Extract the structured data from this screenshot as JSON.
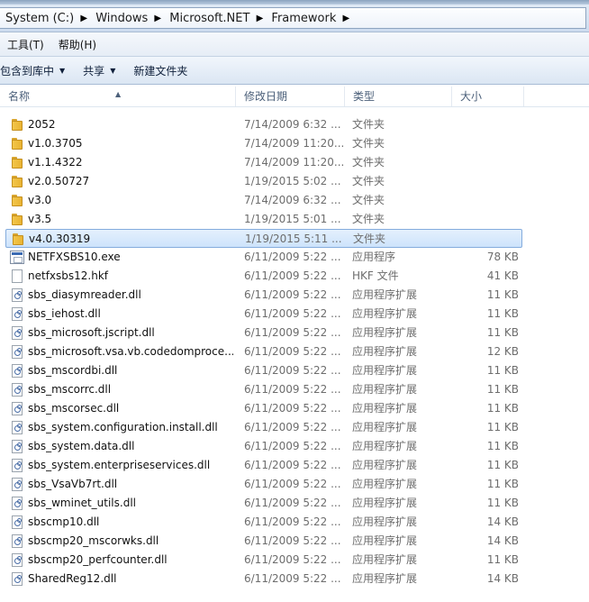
{
  "address": {
    "crumbs": [
      "System (C:)",
      "Windows",
      "Microsoft.NET",
      "Framework"
    ]
  },
  "menu": [
    "工具(T)",
    "帮助(H)"
  ],
  "toolbar": {
    "include_in_library": "包含到库中",
    "share": "共享",
    "new_folder": "新建文件夹"
  },
  "columns": {
    "name": "名称",
    "date": "修改日期",
    "type": "类型",
    "size": "大小"
  },
  "files": [
    {
      "name": "2052",
      "date": "7/14/2009 6:32 ...",
      "type": "文件夹",
      "size": "",
      "icon": "folder-icon"
    },
    {
      "name": "v1.0.3705",
      "date": "7/14/2009 11:20...",
      "type": "文件夹",
      "size": "",
      "icon": "folder-icon"
    },
    {
      "name": "v1.1.4322",
      "date": "7/14/2009 11:20...",
      "type": "文件夹",
      "size": "",
      "icon": "folder-icon"
    },
    {
      "name": "v2.0.50727",
      "date": "1/19/2015 5:02 ...",
      "type": "文件夹",
      "size": "",
      "icon": "folder-icon"
    },
    {
      "name": "v3.0",
      "date": "7/14/2009 6:32 ...",
      "type": "文件夹",
      "size": "",
      "icon": "folder-icon"
    },
    {
      "name": "v3.5",
      "date": "1/19/2015 5:01 ...",
      "type": "文件夹",
      "size": "",
      "icon": "folder-icon"
    },
    {
      "name": "v4.0.30319",
      "date": "1/19/2015 5:11 ...",
      "type": "文件夹",
      "size": "",
      "icon": "folder-icon",
      "selected": true
    },
    {
      "name": "NETFXSBS10.exe",
      "date": "6/11/2009 5:22 ...",
      "type": "应用程序",
      "size": "78 KB",
      "icon": "exe-icon"
    },
    {
      "name": "netfxsbs12.hkf",
      "date": "6/11/2009 5:22 ...",
      "type": "HKF 文件",
      "size": "41 KB",
      "icon": "file-icon"
    },
    {
      "name": "sbs_diasymreader.dll",
      "date": "6/11/2009 5:22 ...",
      "type": "应用程序扩展",
      "size": "11 KB",
      "icon": "dll-icon"
    },
    {
      "name": "sbs_iehost.dll",
      "date": "6/11/2009 5:22 ...",
      "type": "应用程序扩展",
      "size": "11 KB",
      "icon": "dll-icon"
    },
    {
      "name": "sbs_microsoft.jscript.dll",
      "date": "6/11/2009 5:22 ...",
      "type": "应用程序扩展",
      "size": "11 KB",
      "icon": "dll-icon"
    },
    {
      "name": "sbs_microsoft.vsa.vb.codedomproce...",
      "date": "6/11/2009 5:22 ...",
      "type": "应用程序扩展",
      "size": "12 KB",
      "icon": "dll-icon"
    },
    {
      "name": "sbs_mscordbi.dll",
      "date": "6/11/2009 5:22 ...",
      "type": "应用程序扩展",
      "size": "11 KB",
      "icon": "dll-icon"
    },
    {
      "name": "sbs_mscorrc.dll",
      "date": "6/11/2009 5:22 ...",
      "type": "应用程序扩展",
      "size": "11 KB",
      "icon": "dll-icon"
    },
    {
      "name": "sbs_mscorsec.dll",
      "date": "6/11/2009 5:22 ...",
      "type": "应用程序扩展",
      "size": "11 KB",
      "icon": "dll-icon"
    },
    {
      "name": "sbs_system.configuration.install.dll",
      "date": "6/11/2009 5:22 ...",
      "type": "应用程序扩展",
      "size": "11 KB",
      "icon": "dll-icon"
    },
    {
      "name": "sbs_system.data.dll",
      "date": "6/11/2009 5:22 ...",
      "type": "应用程序扩展",
      "size": "11 KB",
      "icon": "dll-icon"
    },
    {
      "name": "sbs_system.enterpriseservices.dll",
      "date": "6/11/2009 5:22 ...",
      "type": "应用程序扩展",
      "size": "11 KB",
      "icon": "dll-icon"
    },
    {
      "name": "sbs_VsaVb7rt.dll",
      "date": "6/11/2009 5:22 ...",
      "type": "应用程序扩展",
      "size": "11 KB",
      "icon": "dll-icon"
    },
    {
      "name": "sbs_wminet_utils.dll",
      "date": "6/11/2009 5:22 ...",
      "type": "应用程序扩展",
      "size": "11 KB",
      "icon": "dll-icon"
    },
    {
      "name": "sbscmp10.dll",
      "date": "6/11/2009 5:22 ...",
      "type": "应用程序扩展",
      "size": "14 KB",
      "icon": "dll-icon"
    },
    {
      "name": "sbscmp20_mscorwks.dll",
      "date": "6/11/2009 5:22 ...",
      "type": "应用程序扩展",
      "size": "14 KB",
      "icon": "dll-icon"
    },
    {
      "name": "sbscmp20_perfcounter.dll",
      "date": "6/11/2009 5:22 ...",
      "type": "应用程序扩展",
      "size": "11 KB",
      "icon": "dll-icon"
    },
    {
      "name": "SharedReg12.dll",
      "date": "6/11/2009 5:22 ...",
      "type": "应用程序扩展",
      "size": "14 KB",
      "icon": "dll-icon"
    }
  ]
}
